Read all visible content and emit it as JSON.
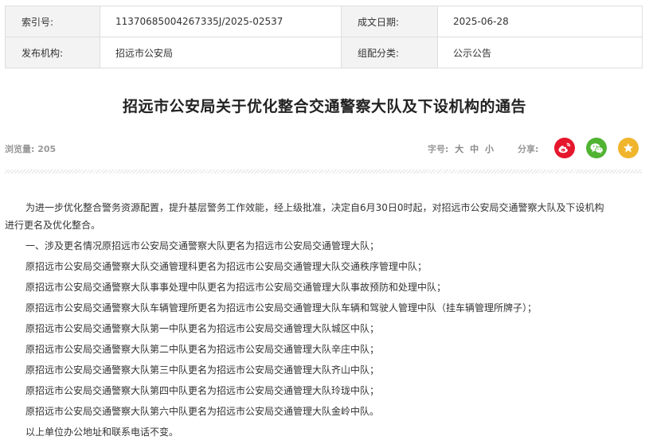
{
  "meta": {
    "index_label": "索引号:",
    "index_value": "11370685004267335J/2025-02537",
    "date_label": "成文日期:",
    "date_value": "2025-06-28",
    "publisher_label": "发布机构:",
    "publisher_value": "招远市公安局",
    "category_label": "组配分类:",
    "category_value": "公示公告"
  },
  "title": "招远市公安局关于优化整合交通警察大队及下设机构的通告",
  "toolbar": {
    "views": "浏览量: 205",
    "font_size_label": "字号:",
    "font_large": "大",
    "font_medium": "中",
    "font_small": "小",
    "share_label": "分享:"
  },
  "icons": {
    "weibo": "weibo-icon",
    "wechat": "wechat-icon",
    "favorite": "star-icon"
  },
  "colors": {
    "weibo": "#e6162d",
    "wechat": "#51b332",
    "favorite": "#f0b52c"
  },
  "body": {
    "lead_first": "为进一步优化整合警务资源配置，提升基层警务工作效能，经上级批准，决定自6月30日0时起，对招远市公安局交通警察大队及下设机构",
    "lead_second": "进行更名及优化整合。",
    "lines": [
      "一、涉及更名情况原招远市公安局交通警察大队更名为招远市公安局交通管理大队；",
      "原招远市公安局交通警察大队交通管理科更名为招远市公安局交通管理大队交通秩序管理中队；",
      "原招远市公安局交通警察大队事事处理中队更名为招远市公安局交通管理大队事故预防和处理中队；",
      "原招远市公安局交通警察大队车辆管理所更名为招远市公安局交通管理大队车辆和驾驶人管理中队（挂车辆管理所牌子）；",
      "原招远市公安局交通警察大队第一中队更名为招远市公安局交通管理大队城区中队；",
      "原招远市公安局交通警察大队第二中队更名为招远市公安局交通管理大队辛庄中队；",
      "原招远市公安局交通警察大队第三中队更名为招远市公安局交通管理大队齐山中队；",
      "原招远市公安局交通警察大队第四中队更名为招远市公安局交通管理大队玲珑中队；",
      "原招远市公安局交通警察大队第六中队更名为招远市公安局交通管理大队金岭中队。",
      "以上单位办公地址和联系电话不变。"
    ]
  }
}
